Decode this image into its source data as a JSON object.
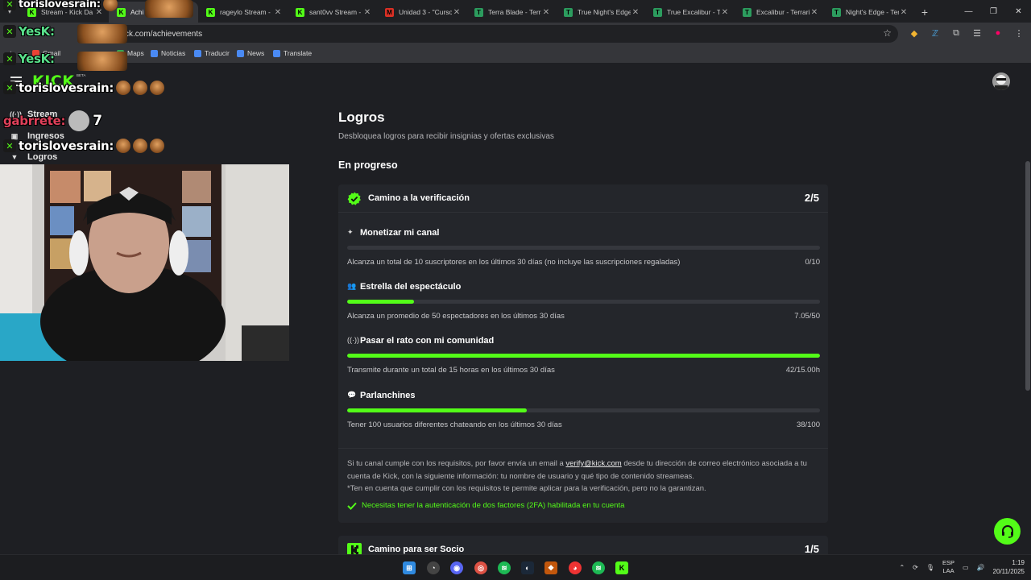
{
  "browser": {
    "tabs": [
      {
        "label": "Stream - Kick Da",
        "favicon_color": "#53fc18",
        "favicon_glyph": "K",
        "active": false
      },
      {
        "label": "Achi",
        "favicon_color": "#53fc18",
        "favicon_glyph": "K",
        "active": true
      },
      {
        "label": "rageylo Stream -",
        "favicon_color": "#53fc18",
        "favicon_glyph": "K",
        "active": false
      },
      {
        "label": "sant0vv Stream -",
        "favicon_color": "#53fc18",
        "favicon_glyph": "K",
        "active": false
      },
      {
        "label": "Unidad 3 - \"Curso",
        "favicon_color": "#d93025",
        "favicon_glyph": "M",
        "active": false
      },
      {
        "label": "Terra Blade - Terra",
        "favicon_color": "#2c9c5e",
        "favicon_glyph": "T",
        "active": false
      },
      {
        "label": "True Night's Edge",
        "favicon_color": "#2c9c5e",
        "favicon_glyph": "T",
        "active": false
      },
      {
        "label": "True Excalibur - Te",
        "favicon_color": "#2c9c5e",
        "favicon_glyph": "T",
        "active": false
      },
      {
        "label": "Excalibur - Terraria",
        "favicon_color": "#2c9c5e",
        "favicon_glyph": "T",
        "active": false
      },
      {
        "label": "Night's Edge - Ter",
        "favicon_color": "#2c9c5e",
        "favicon_glyph": "T",
        "active": false
      }
    ],
    "close_glyph": "✕",
    "new_tab_glyph": "+",
    "address": "ck.com/achievements",
    "bookmarks": [
      {
        "label": "Gmail",
        "color": "#ea4335"
      },
      {
        "label": "Maps",
        "color": "#34a853"
      },
      {
        "label": "Noticias",
        "color": "#4a8af4"
      },
      {
        "label": "Traducir",
        "color": "#4a8af4"
      },
      {
        "label": "News",
        "color": "#4a8af4"
      },
      {
        "label": "Translate",
        "color": "#4a8af4"
      }
    ]
  },
  "site": {
    "logo": "KICK",
    "logo_badge": "BETA",
    "accent": "#53fc18",
    "nav": [
      {
        "label": "Stream",
        "icon": "broadcast-icon",
        "glyph": "((·))"
      },
      {
        "label": "Ingresos",
        "icon": "wallet-icon",
        "glyph": "▣"
      },
      {
        "label": "Logros",
        "icon": "trophy-icon",
        "glyph": "🏆"
      }
    ]
  },
  "main": {
    "title": "Logros",
    "subtitle": "Desbloquea logros para recibir insignias y ofertas exclusivas",
    "section_title": "En progreso",
    "card1": {
      "title": "Camino a la verificación",
      "count": "2/5",
      "achievements": [
        {
          "icon": "sparkle-icon",
          "glyph": "✦",
          "title": "Monetizar mi canal",
          "description": "Alcanza un total de 10 suscriptores en los últimos 30 días (no incluye las suscripciones regaladas)",
          "value": "0/10",
          "progress": 0
        },
        {
          "icon": "users-icon",
          "glyph": "👥",
          "title": "Estrella del espectáculo",
          "description": "Alcanza un promedio de 50 espectadores en los últimos 30 días",
          "value": "7.05/50",
          "progress": 0.141
        },
        {
          "icon": "broadcast-icon",
          "glyph": "((·))",
          "title": "Pasar el rato con mi comunidad",
          "description": "Transmite durante un total de 15 horas en los últimos 30 días",
          "value": "42/15.00h",
          "progress": 1
        },
        {
          "icon": "chat-icon",
          "glyph": "💬",
          "title": "Parlanchines",
          "description": "Tener 100 usuarios diferentes chateando en los últimos 30 días",
          "value": "38/100",
          "progress": 0.38
        }
      ],
      "note_before_link": "Si tu canal cumple con los requisitos, por favor envía un email a ",
      "note_link": "verify@kick.com",
      "note_after_link": " desde tu dirección de correo electrónico asociada a tu cuenta de Kick, con la siguiente información: tu nombre de usuario y qué tipo de contenido streameas.",
      "note_disclaimer": "*Ten en cuenta que cumplir con los requisitos te permite aplicar para la verificación, pero no la garantizan.",
      "twofa_text": "Necesitas tener la autenticación de dos factores (2FA) habilitada en tu cuenta"
    },
    "card2": {
      "title": "Camino para ser Socio",
      "count": "1/5"
    }
  },
  "overlay": {
    "chat_names": [
      "torislovesrain:",
      "torislovesrain:",
      "torislovesrain:",
      "YesK:",
      "YesK:"
    ],
    "gab_name": "gabrrete:",
    "gab_count": "7"
  },
  "taskbar": {
    "lang_top": "ESP",
    "lang_bottom": "LAA",
    "time": "1:19",
    "date": "20/11/2025"
  }
}
